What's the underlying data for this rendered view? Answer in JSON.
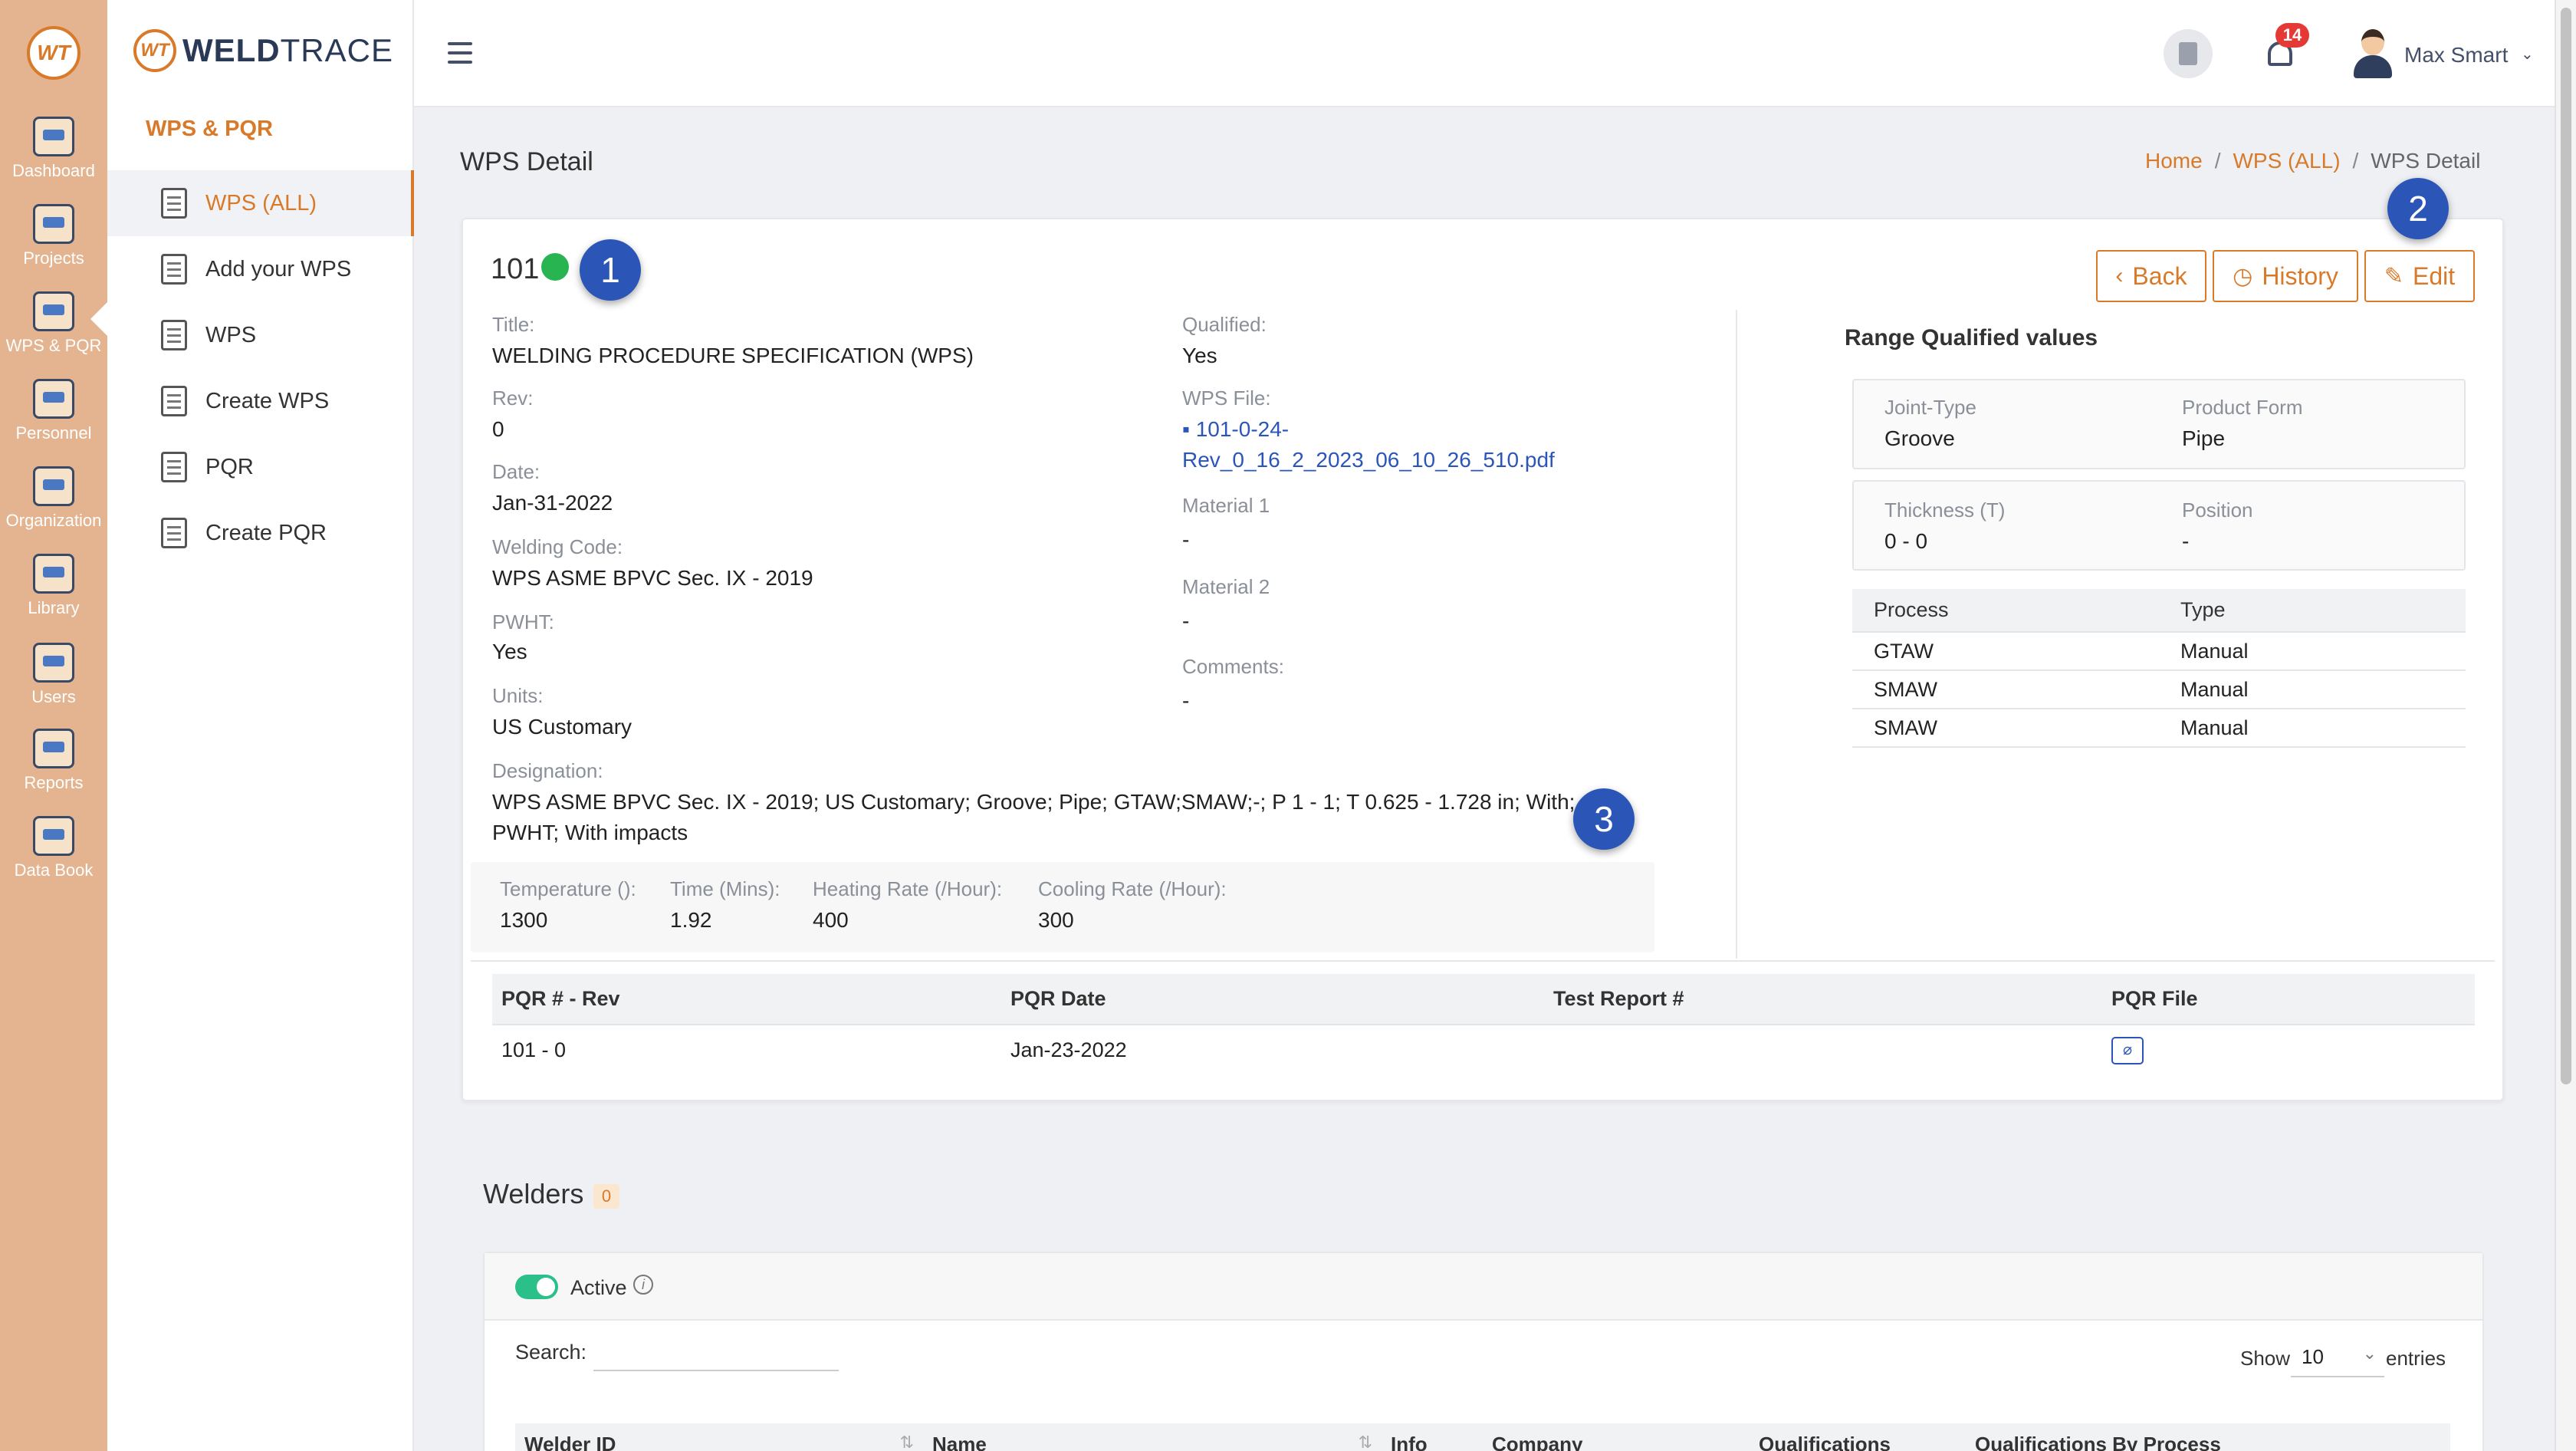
{
  "app": {
    "brand": "WELDTRACE",
    "brand_part1": "WELD",
    "brand_part2": "TRACE",
    "logo_text": "WT"
  },
  "rail": {
    "items": [
      {
        "label": "Dashboard",
        "icon": "monitor-icon"
      },
      {
        "label": "Projects",
        "icon": "folder-icon"
      },
      {
        "label": "WPS & PQR",
        "icon": "clipboard-gear-icon"
      },
      {
        "label": "Personnel",
        "icon": "welder-icon"
      },
      {
        "label": "Organization",
        "icon": "org-chart-icon"
      },
      {
        "label": "Library",
        "icon": "books-icon"
      },
      {
        "label": "Users",
        "icon": "users-icon"
      },
      {
        "label": "Reports",
        "icon": "report-clock-icon"
      },
      {
        "label": "Data Book",
        "icon": "data-book-icon"
      }
    ]
  },
  "sidebar": {
    "section": "WPS & PQR",
    "items": [
      {
        "label": "WPS (ALL)",
        "icon": "clipboard-icon",
        "active": true
      },
      {
        "label": "Add your WPS",
        "icon": "document-add-icon"
      },
      {
        "label": "WPS",
        "icon": "document-icon"
      },
      {
        "label": "Create WPS",
        "icon": "document-edit-icon"
      },
      {
        "label": "PQR",
        "icon": "document-list-icon"
      },
      {
        "label": "Create PQR",
        "icon": "document-check-icon"
      }
    ]
  },
  "topbar": {
    "notifications_count": "14",
    "user_name": "Max Smart",
    "caret": "⌄"
  },
  "page": {
    "title": "WPS Detail",
    "breadcrumb": {
      "home": "Home",
      "sep": "/",
      "section": "WPS (ALL)",
      "current": "WPS Detail"
    }
  },
  "markers": [
    "1",
    "2",
    "3"
  ],
  "wps": {
    "number": "101",
    "status_color": "#28b450",
    "buttons": {
      "back": "Back",
      "history": "History",
      "edit": "Edit",
      "back_icon": "‹",
      "history_icon": "◷",
      "edit_icon": "✎"
    },
    "left": {
      "title_label": "Title:",
      "title": "WELDING PROCEDURE SPECIFICATION (WPS)",
      "rev_label": "Rev:",
      "rev": "0",
      "date_label": "Date:",
      "date": "Jan-31-2022",
      "code_label": "Welding Code:",
      "code": "WPS ASME BPVC Sec. IX - 2019",
      "pwht_label": "PWHT:",
      "pwht": "Yes",
      "units_label": "Units:",
      "units": "US Customary",
      "designation_label": "Designation:",
      "designation_line1": "WPS ASME BPVC Sec. IX - 2019; US Customary; Groove; Pipe; GTAW;SMAW;-; P 1 - 1; T 0.625 - 1.728 in; With;",
      "designation_line2": "PWHT; With impacts"
    },
    "middle": {
      "qualified_label": "Qualified:",
      "qualified": "Yes",
      "file_label": "WPS File:",
      "file_line1": "101-0-24-",
      "file_line2": "Rev_0_16_2_2023_06_10_26_510.pdf",
      "material1_label": "Material 1",
      "material1": "-",
      "material2_label": "Material 2",
      "material2": "-",
      "comments_label": "Comments:",
      "comments": "-"
    },
    "pwht_details": {
      "temperature_label": "Temperature ():",
      "temperature": "1300",
      "time_label": "Time (Mins):",
      "time": "1.92",
      "heating_label": "Heating Rate (/Hour):",
      "heating": "400",
      "cooling_label": "Cooling Rate (/Hour):",
      "cooling": "300"
    },
    "range_qualified": {
      "title": "Range Qualified values",
      "joint_type_label": "Joint-Type",
      "joint_type": "Groove",
      "product_form_label": "Product Form",
      "product_form": "Pipe",
      "thickness_label": "Thickness (T)",
      "thickness": "0 - 0",
      "position_label": "Position",
      "position": "-",
      "process_header": "Process",
      "type_header": "Type",
      "rows": [
        {
          "process": "GTAW",
          "type": "Manual"
        },
        {
          "process": "SMAW",
          "type": "Manual"
        },
        {
          "process": "SMAW",
          "type": "Manual"
        }
      ]
    },
    "pqr_table": {
      "headers": [
        "PQR # - Rev",
        "PQR Date",
        "Test Report #",
        "PQR File"
      ],
      "rows": [
        {
          "pqr": "101 - 0",
          "date": "Jan-23-2022",
          "report": ""
        }
      ],
      "clip_icon": "⌀"
    }
  },
  "welders": {
    "title": "Welders",
    "count": "0",
    "active_label": "Active",
    "info_glyph": "i",
    "search_label": "Search:",
    "search_value": "",
    "show_label": "Show",
    "show_value": "10",
    "entries_label": "entries",
    "sort_glyph": "⇅",
    "headers": [
      "Welder ID",
      "Name",
      "Info",
      "Company",
      "Qualifications",
      "Qualifications By Process"
    ]
  }
}
